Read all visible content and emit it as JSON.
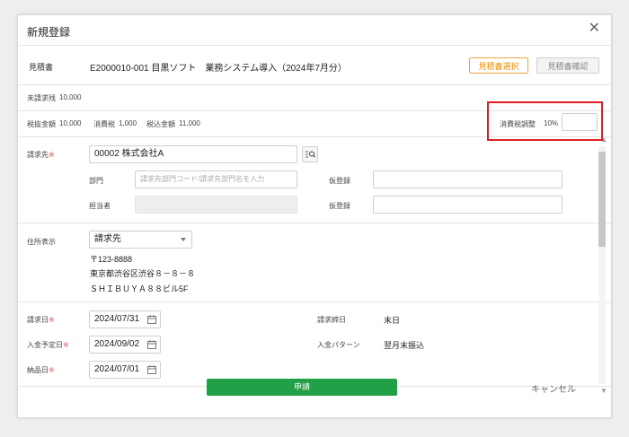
{
  "modal": {
    "title": "新規登録",
    "close_symbol": "✕"
  },
  "estimate": {
    "label": "見積書",
    "value": "E2000010-001 目黒ソフト　業務システム導入（2024年7月分）",
    "select_button": "見積書選択",
    "confirm_button": "見積書確認"
  },
  "summary": {
    "unbilled_label": "未請求残",
    "unbilled_value": "10,000",
    "pretax_label": "税抜金額",
    "pretax_value": "10,000",
    "tax_label": "消費税",
    "tax_value": "1,000",
    "taxin_label": "税込金額",
    "taxin_value": "11,000",
    "tax_adjust_label": "消費税調整",
    "tax_rate": "10%",
    "tax_adjust_value": ""
  },
  "billing": {
    "label": "請求先",
    "required_mark": "※",
    "value": "00002 株式会社A",
    "dept_label": "部門",
    "dept_placeholder": "請求先部門コード/請求先部門名を入力",
    "person_label": "担当者",
    "person_value": "",
    "temp1_label": "仮登録",
    "temp1_value": "",
    "temp2_label": "仮登録",
    "temp2_value": ""
  },
  "address": {
    "label": "住所表示",
    "select_value": "請求先",
    "postal": "〒123-8888",
    "line1": "東京都渋谷区渋谷８－８－８",
    "line2": "ＳＨＩＢＵＹＡ８８ビル5F"
  },
  "dates": {
    "billing_date_label": "請求日",
    "billing_date_value": "2024/07/31",
    "payment_date_label": "入金予定日",
    "payment_date_value": "2024/09/02",
    "delivery_date_label": "納品日",
    "delivery_date_value": "2024/07/01",
    "closing_label": "請求締日",
    "closing_value": "末日",
    "pattern_label": "入金パターン",
    "pattern_value": "翌月末振込",
    "required_mark": "※"
  },
  "footer": {
    "submit": "申請",
    "cancel": "キャンセル"
  },
  "colors": {
    "accent_green": "#22a047",
    "highlight_red": "#e02020",
    "orange": "#f08c00"
  },
  "icons": [
    "close-icon",
    "search-list-icon",
    "calendar-icon",
    "chevron-down-icon"
  ]
}
